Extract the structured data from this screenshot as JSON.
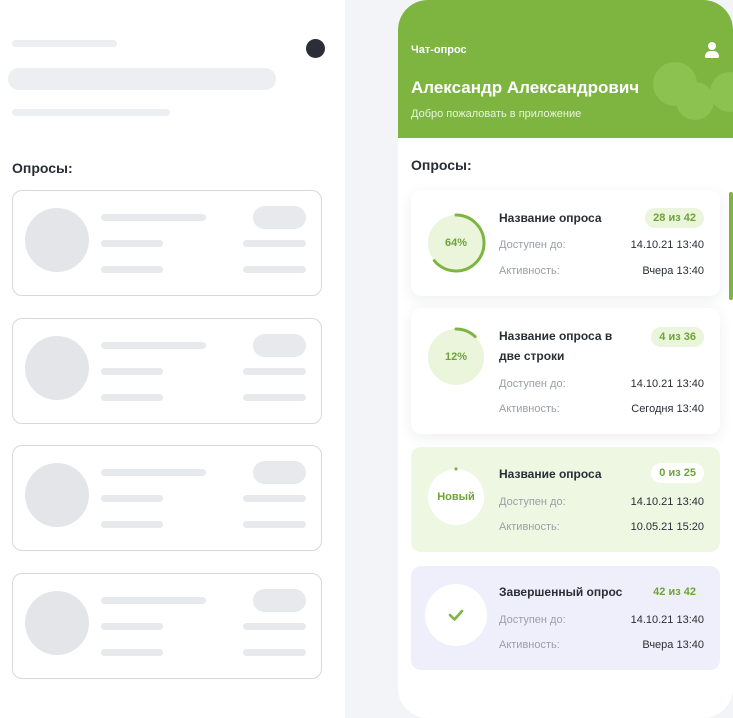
{
  "app": {
    "title": "Чат-опрос",
    "user_name": "Александр Александрович",
    "welcome": "Добро пожаловать в приложение"
  },
  "skeleton": {
    "section_title": "Опросы:"
  },
  "surveys": {
    "section_title": "Опросы:",
    "items": [
      {
        "status": "active",
        "progress_label": "64%",
        "progress": 0.64,
        "title": "Название опроса",
        "badge": "28 из 42",
        "available_label": "Доступен до:",
        "available_value": "14.10.21 13:40",
        "activity_label": "Активность:",
        "activity_value": "Вчера 13:40"
      },
      {
        "status": "active",
        "progress_label": "12%",
        "progress": 0.12,
        "title": "Название опроса в две строки",
        "badge": "4 из 36",
        "available_label": "Доступен до:",
        "available_value": "14.10.21 13:40",
        "activity_label": "Активность:",
        "activity_value": "Сегодня 13:40"
      },
      {
        "status": "new",
        "progress_label": "Новый",
        "progress": 0.0,
        "title": "Название опроса",
        "badge": "0 из 25",
        "available_label": "Доступен до:",
        "available_value": "14.10.21 13:40",
        "activity_label": "Активность:",
        "activity_value": "10.05.21 15:20"
      },
      {
        "status": "done",
        "progress_label": "",
        "progress": 1.0,
        "title": "Завершенный опрос",
        "badge": "42 из 42",
        "available_label": "Доступен до:",
        "available_value": "14.10.21 13:40",
        "activity_label": "Активность:",
        "activity_value": "Вчера 13:40"
      }
    ]
  },
  "colors": {
    "accent": "#7db540",
    "accent_text": "#6ea338",
    "ring_track": "#eaf5dc",
    "new_bg": "#eef7e2",
    "done_bg": "#eeeffa"
  },
  "icons": {
    "user": "user-icon",
    "check": "check-icon"
  }
}
